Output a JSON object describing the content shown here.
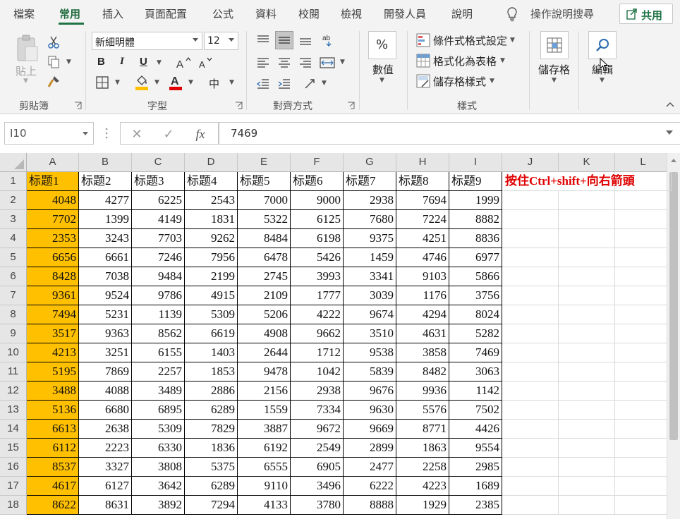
{
  "tabs": [
    {
      "label": "檔案",
      "active": false
    },
    {
      "label": "常用",
      "active": true
    },
    {
      "label": "插入",
      "active": false
    },
    {
      "label": "頁面配置",
      "active": false
    },
    {
      "label": "公式",
      "active": false
    },
    {
      "label": "資料",
      "active": false
    },
    {
      "label": "校閱",
      "active": false
    },
    {
      "label": "檢視",
      "active": false
    },
    {
      "label": "開發人員",
      "active": false
    },
    {
      "label": "說明",
      "active": false
    }
  ],
  "tell_me": "操作說明搜尋",
  "share_label": "共用",
  "ribbon": {
    "clipboard": {
      "paste_label": "貼上",
      "group_label": "剪貼簿"
    },
    "font": {
      "font_name": "新細明體",
      "font_size": "12",
      "group_label": "字型",
      "bold": "B",
      "italic": "I",
      "underline": "U",
      "phonetic": "中"
    },
    "alignment": {
      "group_label": "對齊方式"
    },
    "number": {
      "label": "數值",
      "percent": "%"
    },
    "styles": {
      "conditional": "條件式格式設定",
      "format_table": "格式化為表格",
      "cell_styles": "儲存格樣式",
      "group_label": "樣式"
    },
    "cells": {
      "label": "儲存格"
    },
    "editing": {
      "label": "編輯"
    }
  },
  "colors": {
    "accent": "#217346",
    "highlight": "#ffc000",
    "note": "#e00000"
  },
  "formula_bar": {
    "name_box": "I10",
    "cancel": "✕",
    "enter": "✓",
    "fx": "fx",
    "value": "7469"
  },
  "columns": [
    "A",
    "B",
    "C",
    "D",
    "E",
    "F",
    "G",
    "H",
    "I",
    "J",
    "K",
    "L"
  ],
  "row_numbers": [
    "1",
    "2",
    "3",
    "4",
    "5",
    "6",
    "7",
    "8",
    "9",
    "10",
    "11",
    "12",
    "13",
    "14",
    "15",
    "16",
    "17",
    "18"
  ],
  "headers": [
    "标题1",
    "标题2",
    "标题3",
    "标题4",
    "标题5",
    "标题6",
    "标题7",
    "标题8",
    "标题9"
  ],
  "note": "按住Ctrl+shift+向右箭頭",
  "rows": [
    [
      "4048",
      "4277",
      "6225",
      "2543",
      "7000",
      "9000",
      "2938",
      "7694",
      "1999"
    ],
    [
      "7702",
      "1399",
      "4149",
      "1831",
      "5322",
      "6125",
      "7680",
      "7224",
      "8882"
    ],
    [
      "2353",
      "3243",
      "7703",
      "9262",
      "8484",
      "6198",
      "9375",
      "4251",
      "8836"
    ],
    [
      "6656",
      "6661",
      "7246",
      "7956",
      "6478",
      "5426",
      "1459",
      "4746",
      "6977"
    ],
    [
      "8428",
      "7038",
      "9484",
      "2199",
      "2745",
      "3993",
      "3341",
      "9103",
      "5866"
    ],
    [
      "9361",
      "9524",
      "9786",
      "4915",
      "2109",
      "1777",
      "3039",
      "1176",
      "3756"
    ],
    [
      "7494",
      "5231",
      "1139",
      "5309",
      "5206",
      "4222",
      "9674",
      "4294",
      "8024"
    ],
    [
      "3517",
      "9363",
      "8562",
      "6619",
      "4908",
      "9662",
      "3510",
      "4631",
      "5282"
    ],
    [
      "4213",
      "3251",
      "6155",
      "1403",
      "2644",
      "1712",
      "9538",
      "3858",
      "7469"
    ],
    [
      "5195",
      "7869",
      "2257",
      "1853",
      "9478",
      "1042",
      "5839",
      "8482",
      "3063"
    ],
    [
      "3488",
      "4088",
      "3489",
      "2886",
      "2156",
      "2938",
      "9676",
      "9936",
      "1142"
    ],
    [
      "5136",
      "6680",
      "6895",
      "6289",
      "1559",
      "7334",
      "9630",
      "5576",
      "7502"
    ],
    [
      "6613",
      "2638",
      "5309",
      "7829",
      "3887",
      "9672",
      "9669",
      "8771",
      "4426"
    ],
    [
      "6112",
      "2223",
      "6330",
      "1836",
      "6192",
      "2549",
      "2899",
      "1863",
      "9554"
    ],
    [
      "8537",
      "3327",
      "3808",
      "5375",
      "6555",
      "6905",
      "2477",
      "2258",
      "2985"
    ],
    [
      "4617",
      "6127",
      "3642",
      "6289",
      "9110",
      "3496",
      "6222",
      "4223",
      "1689"
    ],
    [
      "8622",
      "8631",
      "3892",
      "7294",
      "4133",
      "3780",
      "8888",
      "1929",
      "2385"
    ]
  ]
}
